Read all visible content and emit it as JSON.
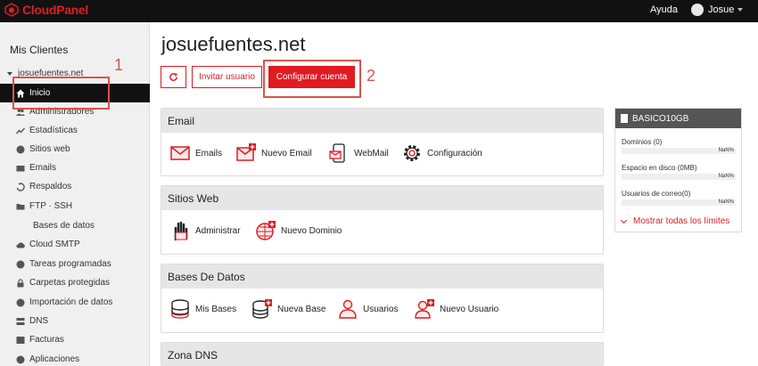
{
  "brand": {
    "name": "CloudPanel"
  },
  "header": {
    "help": "Ayuda",
    "user": "Josue"
  },
  "sidebar": {
    "title": "Mis Clientes",
    "client": "josuefuentes.net",
    "items": [
      {
        "label": "Inicio",
        "icon": "home-icon"
      },
      {
        "label": "Administradores",
        "icon": "users-icon"
      },
      {
        "label": "Estadísticas",
        "icon": "chart-icon"
      },
      {
        "label": "Sitios web",
        "icon": "globe-icon"
      },
      {
        "label": "Emails",
        "icon": "envelope-icon"
      },
      {
        "label": "Respaldos",
        "icon": "restore-icon"
      },
      {
        "label": "FTP · SSH",
        "icon": "folder-icon"
      },
      {
        "label": "Bases de datos",
        "icon": "database-icon"
      },
      {
        "label": "Cloud SMTP",
        "icon": "cloud-icon"
      },
      {
        "label": "Tareas programadas",
        "icon": "clock-icon"
      },
      {
        "label": "Carpetas protegidas",
        "icon": "lock-icon"
      },
      {
        "label": "Importación de datos",
        "icon": "import-icon"
      },
      {
        "label": "DNS",
        "icon": "dns-icon"
      },
      {
        "label": "Facturas",
        "icon": "invoice-icon"
      },
      {
        "label": "Aplicaciones",
        "icon": "apps-icon"
      }
    ]
  },
  "main": {
    "title": "josuefuentes.net",
    "buttons": {
      "invite": "Invitar usuario",
      "configure": "Configurar cuenta"
    },
    "annotations": [
      "1",
      "2"
    ],
    "sections": {
      "email": {
        "title": "Email",
        "tools": [
          "Emails",
          "Nuevo Email",
          "WebMail",
          "Configuración"
        ]
      },
      "sites": {
        "title": "Sitios Web",
        "tools": [
          "Administrar",
          "Nuevo Dominio"
        ]
      },
      "databases": {
        "title": "Bases De Datos",
        "tools": [
          "Mis Bases",
          "Nueva Base",
          "Usuarios",
          "Nuevo Usuario"
        ]
      },
      "dns": {
        "title": "Zona DNS"
      }
    }
  },
  "plan": {
    "name": "BASICO10GB",
    "rows": [
      {
        "label": "Dominios (0)",
        "value": "NaN%"
      },
      {
        "label": "Espacio en disco (0MB)",
        "value": "NaN%"
      },
      {
        "label": "Usuarios de correo(0)",
        "value": "NaN%"
      }
    ],
    "show_all": "Mostrar todas los límites"
  },
  "colors": {
    "accent": "#e11b22",
    "topbar": "#111111",
    "annotation": "#d9534f"
  }
}
